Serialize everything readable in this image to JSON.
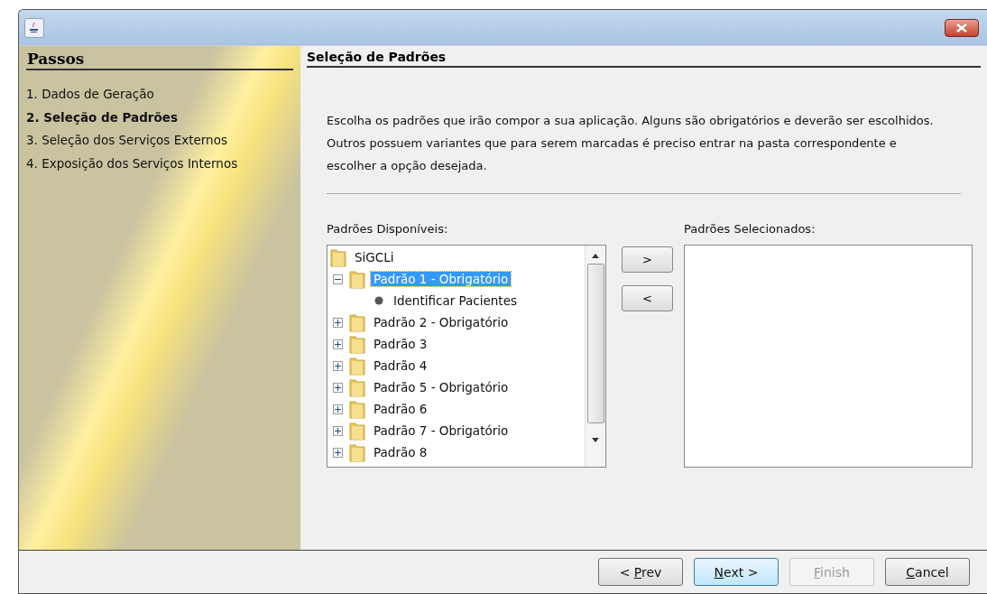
{
  "steps": {
    "title": "Passos",
    "items": [
      {
        "label": "1. Dados de Geração",
        "selected": false
      },
      {
        "label": "2. Seleção de Padrões",
        "selected": true
      },
      {
        "label": "3. Seleção dos Serviços Externos",
        "selected": false
      },
      {
        "label": "4. Exposição dos Serviços Internos",
        "selected": false
      }
    ]
  },
  "page": {
    "title": "Seleção de Padrões",
    "description": "Escolha os padrões que irão compor a sua aplicação. Alguns são obrigatórios e deverão ser escolhidos. Outros possuem variantes que para serem marcadas é preciso entrar na pasta correspondente e escolher a opção desejada."
  },
  "available": {
    "label": "Padrões Disponíveis:",
    "tree": [
      {
        "label": "SiGCLi",
        "kind": "folder",
        "selected": false,
        "children": [
          {
            "label": "Padrão 1 - Obrigatório",
            "kind": "folder",
            "expanded": true,
            "selected": true,
            "children": [
              {
                "label": "Identificar Pacientes",
                "kind": "leaf",
                "selected": false
              }
            ]
          },
          {
            "label": "Padrão 2 - Obrigatório",
            "kind": "folder",
            "expanded": false,
            "selected": false
          },
          {
            "label": "Padrão 3",
            "kind": "folder",
            "expanded": false,
            "selected": false
          },
          {
            "label": "Padrão 4",
            "kind": "folder",
            "expanded": false,
            "selected": false
          },
          {
            "label": "Padrão 5 - Obrigatório",
            "kind": "folder",
            "expanded": false,
            "selected": false
          },
          {
            "label": "Padrão 6",
            "kind": "folder",
            "expanded": false,
            "selected": false
          },
          {
            "label": "Padrão 7 - Obrigatório",
            "kind": "folder",
            "expanded": false,
            "selected": false
          },
          {
            "label": "Padrão 8",
            "kind": "folder",
            "expanded": false,
            "selected": false
          }
        ]
      }
    ]
  },
  "transfer_buttons": [
    ">",
    "<"
  ],
  "selected_list": {
    "label": "Padrões Selecionados:"
  },
  "footer_buttons": [
    {
      "label": "< Prev",
      "disabled": false,
      "focused": false
    },
    {
      "label": "Next >",
      "disabled": false,
      "focused": true
    },
    {
      "label": "Finish",
      "disabled": true,
      "focused": false
    },
    {
      "label": "Cancel",
      "disabled": false,
      "focused": false
    }
  ]
}
